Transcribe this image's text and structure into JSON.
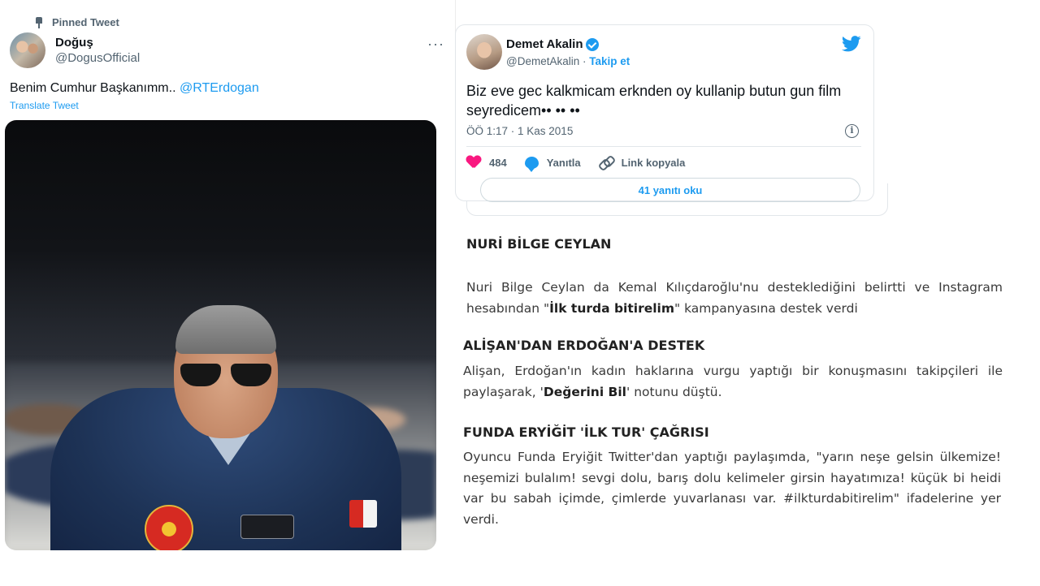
{
  "left_tweet": {
    "pinned_label": "Pinned Tweet",
    "author_name": "Doğuş",
    "author_handle": "@DogusOfficial",
    "more_icon": "···",
    "text_before": "Benim Cumhur Başkanımm.. ",
    "mention": "@RTErdogan",
    "translate_label": "Translate Tweet"
  },
  "right_tweet": {
    "author_name": "Demet Akalin",
    "author_handle": "@DemetAkalin",
    "separator": " · ",
    "follow_label": "Takip et",
    "text": "Biz eve gec kalkmicam erknden oy kullanip butun gun film seyredicem•• •• ••",
    "timestamp": "ÖÖ 1:17 · 1 Kas 2015",
    "info_glyph": "i",
    "likes": "484",
    "reply_label": "Yanıtla",
    "copy_link_label": "Link kopyala",
    "read_replies_label": "41 yanıtı oku"
  },
  "article": {
    "s1_heading": "NURİ BİLGE CEYLAN",
    "s1_text_a": "Nuri Bilge Ceylan da Kemal Kılıçdaroğlu'nu desteklediğini belirtti ve Instagram hesabından \"",
    "s1_bold": "İlk turda bitirelim",
    "s1_text_b": "\" kampanyasına destek verdi",
    "s2_heading": "ALİŞAN'DAN ERDOĞAN'A DESTEK",
    "s2_text_a": "Alişan, Erdoğan'ın kadın haklarına vurgu yaptığı bir konuşmasını takipçileri ile paylaşarak, '",
    "s2_bold": "Değerini Bil",
    "s2_text_b": "' notunu düştü.",
    "s3_heading": "FUNDA ERYİĞİT 'İLK TUR' ÇAĞRISI",
    "s3_text": "Oyuncu Funda Eryiğit Twitter'dan yaptığı paylaşımda, \"yarın neşe gelsin ülkemize! neşemizi bulalım! sevgi dolu, barış dolu kelimeler girsin hayatımıza! küçük bi heidi var bu sabah içimde, çimlerde yuvarlanası var. #ilkturdabitirelim\" ifadelerine yer verdi."
  },
  "icons": [
    "pin-icon",
    "more-icon",
    "verified-icon",
    "twitter-bird-icon",
    "info-icon",
    "heart-icon",
    "reply-bubble-icon",
    "link-icon"
  ],
  "colors": {
    "twitter_blue": "#1d9bf0",
    "like_pink": "#f91880",
    "secondary_text": "#536471"
  }
}
